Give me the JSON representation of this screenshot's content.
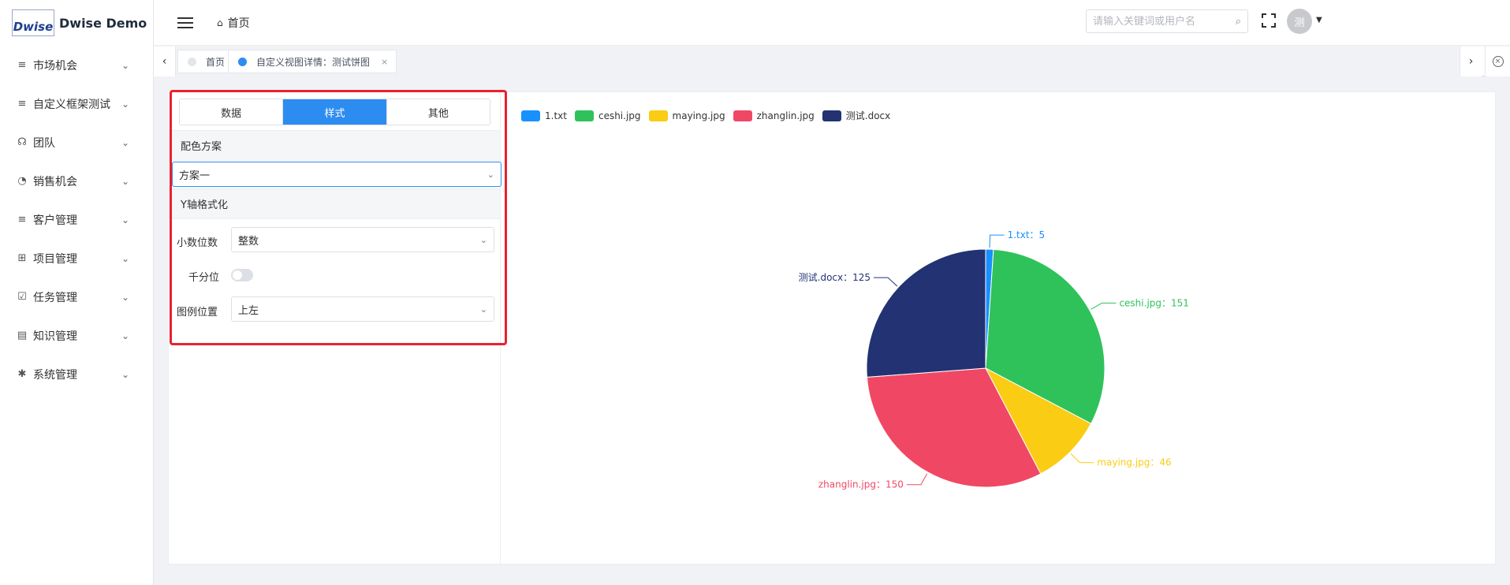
{
  "app": {
    "logo_text": "Dwise",
    "title": "Dwise Demo"
  },
  "sidebar": {
    "items": [
      {
        "label": "市场机会",
        "icon": "list-icon",
        "glyph": "≡"
      },
      {
        "label": "自定义框架测试",
        "icon": "list-icon",
        "glyph": "≡"
      },
      {
        "label": "团队",
        "icon": "team-icon",
        "glyph": "☊"
      },
      {
        "label": "销售机会",
        "icon": "pie-chart-icon",
        "glyph": "◔"
      },
      {
        "label": "客户管理",
        "icon": "list-icon",
        "glyph": "≡"
      },
      {
        "label": "项目管理",
        "icon": "grid-icon",
        "glyph": "⊞"
      },
      {
        "label": "任务管理",
        "icon": "checkbox-icon",
        "glyph": "☑"
      },
      {
        "label": "知识管理",
        "icon": "book-icon",
        "glyph": "▤"
      },
      {
        "label": "系统管理",
        "icon": "gear-icon",
        "glyph": "✱"
      }
    ]
  },
  "header": {
    "breadcrumb": "首页",
    "search_placeholder": "请输入关键词或用户名",
    "avatar_text": "测"
  },
  "tabs": [
    {
      "label": "首页",
      "active": false
    },
    {
      "label": "自定义视图详情：测试饼图",
      "active": true,
      "close": "×"
    }
  ],
  "tabbar": {
    "left_arrow": "‹",
    "right_arrow": "›",
    "close_all": "×"
  },
  "panel": {
    "segments": [
      {
        "label": "数据",
        "active": false
      },
      {
        "label": "样式",
        "active": true
      },
      {
        "label": "其他",
        "active": false
      }
    ],
    "color_scheme": {
      "section_title": "配色方案",
      "value": "方案一"
    },
    "yaxis": {
      "section_title": "Y轴格式化",
      "decimal_label": "小数位数",
      "decimal_value": "整数",
      "thousands_label": "千分位",
      "thousands_on": false,
      "legend_pos_label": "图例位置",
      "legend_pos_value": "上左"
    }
  },
  "colors": {
    "accent": "#2d8cf0",
    "highlight_border": "#e8222e"
  },
  "chart_data": {
    "type": "pie",
    "legend_position": "top-left",
    "slices": [
      {
        "name": "1.txt",
        "value": 5,
        "color": "#1890ff",
        "label": "1.txt：5"
      },
      {
        "name": "ceshi.jpg",
        "value": 151,
        "color": "#2fc25b",
        "label": "ceshi.jpg：151"
      },
      {
        "name": "maying.jpg",
        "value": 46,
        "color": "#facc14",
        "label": "maying.jpg：46"
      },
      {
        "name": "zhanglin.jpg",
        "value": 150,
        "color": "#f04864",
        "label": "zhanglin.jpg：150"
      },
      {
        "name": "测试.docx",
        "value": 125,
        "color": "#223273",
        "label": "测试.docx：125"
      }
    ]
  }
}
